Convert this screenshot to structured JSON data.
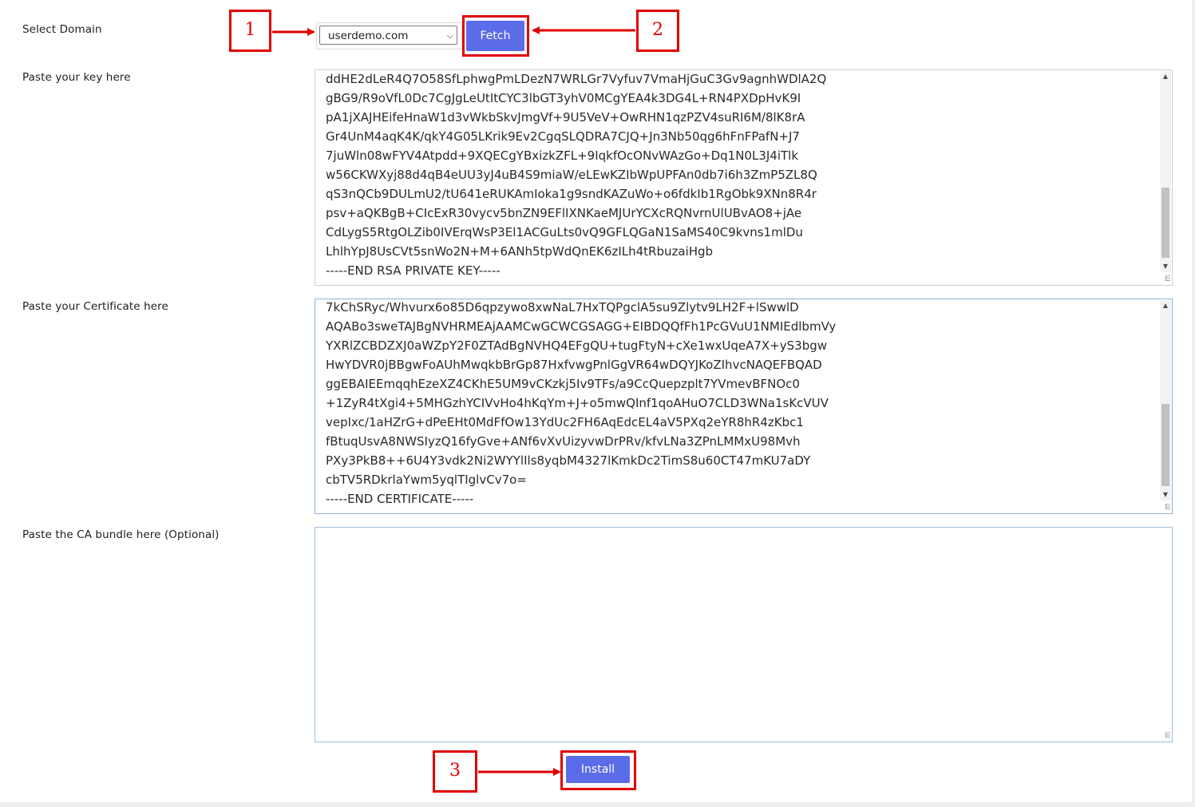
{
  "form": {
    "domain_label": "Select Domain",
    "domain_selected": "userdemo.com",
    "fetch_label": "Fetch",
    "key_label": "Paste your key here",
    "cert_label": "Paste your Certificate here",
    "ca_label": "Paste the CA bundle here (Optional)",
    "install_label": "Install",
    "key_lines": [
      "ddHE2dLeR4Q7O58SfLphwgPmLDezN7WRLGr7Vyfuv7VmaHjGuC3Gv9agnhWDlA2Q",
      "gBG9/R9oVfL0Dc7CgJgLeUtItCYC3lbGT3yhV0MCgYEA4k3DG4L+RN4PXDpHvK9I",
      "pA1jXAJHEifeHnaW1d3vWkbSkvJmgVf+9U5VeV+OwRHN1qzPZV4suRI6M/8lK8rA",
      "Gr4UnM4aqK4K/qkY4G05LKrik9Ev2CgqSLQDRA7CJQ+Jn3Nb50qg6hFnFPafN+J7",
      "7juWln08wFYV4Atpdd+9XQECgYBxizkZFL+9IqkfOcONvWAzGo+Dq1N0L3J4iTlk",
      "w56CKWXyj88d4qB4eUU3yJ4uB4S9miaW/eLEwKZIbWpUPFAn0db7i6h3ZmP5ZL8Q",
      "qS3nQCb9DULmU2/tU641eRUKAmIoka1g9sndKAZuWo+o6fdkIb1RgObk9XNn8R4r",
      "psv+aQKBgB+CIcExR30vycv5bnZN9EFlIXNKaeMJUrYCXcRQNvrnUlUBvAO8+jAe",
      "CdLygS5RtgOLZib0IVErqWsP3El1ACGuLts0vQ9GFLQGaN1SaMS40C9kvns1mlDu",
      "LhlhYpJ8UsCVt5snWo2N+M+6ANh5tpWdQnEK6zILh4tRbuzaiHgb",
      "-----END RSA PRIVATE KEY-----"
    ],
    "cert_lines": [
      "7kChSRyc/Whvurx6o85D6qpzywo8xwNaL7HxTQPgclA5su9Zlytv9LH2F+lSwwlD",
      "AQABo3sweTAJBgNVHRMEAjAAMCwGCWCGSAGG+EIBDQQfFh1PcGVuU1NMIEdlbmVy",
      "YXRlZCBDZXJ0aWZpY2F0ZTAdBgNVHQ4EFgQU+tugFtyN+cXe1wxUqeA7X+yS3bgw",
      "HwYDVR0jBBgwFoAUhMwqkbBrGp87HxfvwgPnlGgVR64wDQYJKoZIhvcNAQEFBQAD",
      "ggEBAIEEmqqhEzeXZ4CKhE5UM9vCKzkj5Iv9TFs/a9CcQuepzplt7YVmevBFNOc0",
      "+1ZyR4tXgi4+5MHGzhYCIVvHo4hKqYm+J+o5mwQInf1qoAHuO7CLD3WNa1sKcVUV",
      "vepIxc/1aHZrG+dPeEHt0MdFfOw13YdUc2FH6AqEdcEL4aV5PXq2eYR8hR4zKbc1",
      "fBtuqUsvA8NWSIyzQ16fyGve+ANf6vXvUizyvwDrPRv/kfvLNa3ZPnLMMxU98Mvh",
      "PXy3PkB8++6U4Y3vdk2Ni2WYYlIls8yqbM4327lKmkDc2TimS8u60CT47mKU7aDY",
      "cbTV5RDkrlaYwm5yqlTIglvCv7o=",
      "-----END CERTIFICATE-----"
    ],
    "ca_value": ""
  },
  "annotations": {
    "step1": "1",
    "step2": "2",
    "step3": "3",
    "color": "#e00000"
  },
  "theme": {
    "button_color": "#5b6ce8"
  }
}
